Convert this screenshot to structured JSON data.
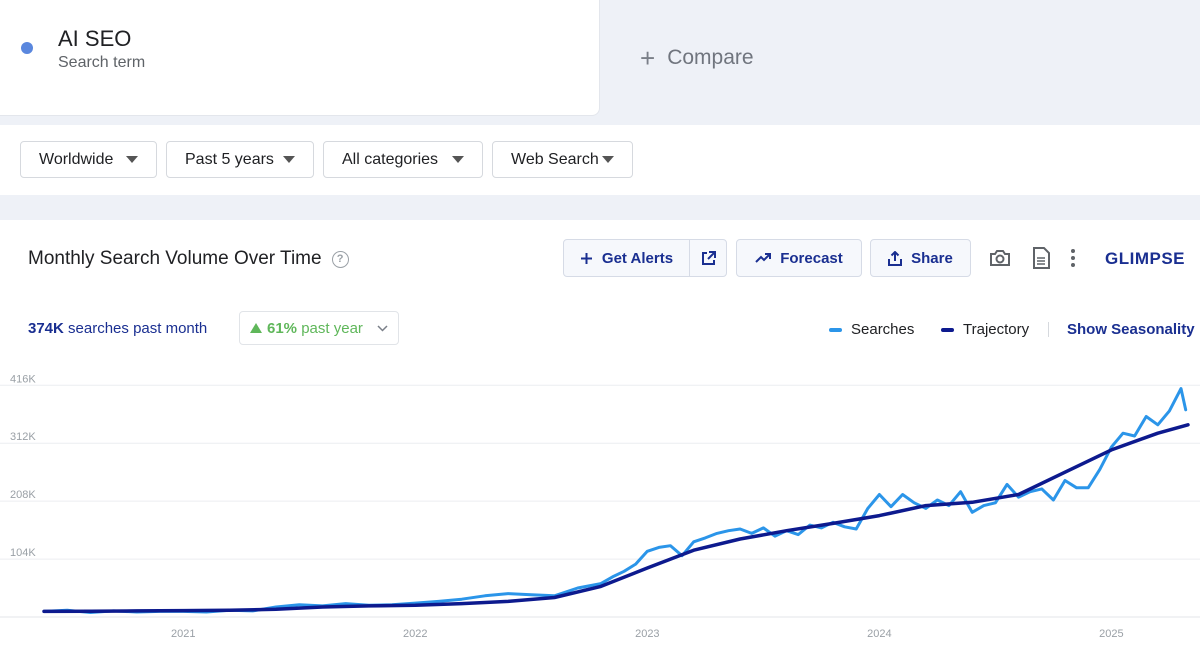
{
  "search_term": {
    "title": "AI SEO",
    "subtitle": "Search term",
    "dot_color": "#5a87de"
  },
  "compare": {
    "label": "Compare"
  },
  "filters": {
    "region": "Worldwide",
    "period": "Past 5 years",
    "category": "All categories",
    "source": "Web Search"
  },
  "panel": {
    "title": "Monthly Search Volume Over Time",
    "get_alerts": "Get Alerts",
    "forecast": "Forecast",
    "share": "Share",
    "logo": "GLIMPSE",
    "stat_value": "374K",
    "stat_label": "searches past month",
    "growth_value": "61%",
    "growth_label": "past year",
    "legend_searches": "Searches",
    "legend_trajectory": "Trajectory",
    "show_seasonality": "Show Seasonality"
  },
  "colors": {
    "searches": "#2b95e9",
    "trajectory": "#0d1a8e",
    "accent": "#1a2f91",
    "growth": "#5fb75a"
  },
  "chart_data": {
    "type": "line",
    "title": "Monthly Search Volume Over Time",
    "y_ticks": [
      "104K",
      "208K",
      "312K",
      "416K"
    ],
    "y_tick_values": [
      104000,
      208000,
      312000,
      416000
    ],
    "x_ticks": [
      "2021",
      "2022",
      "2023",
      "2024",
      "2025"
    ],
    "x_tick_values": [
      2021,
      2022,
      2023,
      2024,
      2025
    ],
    "xlim": [
      2020.37,
      2025.35
    ],
    "ylim": [
      0,
      460000
    ],
    "grid": true,
    "legend_position": "top-right",
    "series": [
      {
        "name": "Searches",
        "x": [
          2020.4,
          2020.5,
          2020.6,
          2020.7,
          2020.8,
          2020.9,
          2021.0,
          2021.1,
          2021.2,
          2021.3,
          2021.4,
          2021.5,
          2021.6,
          2021.7,
          2021.8,
          2021.9,
          2022.0,
          2022.1,
          2022.2,
          2022.3,
          2022.4,
          2022.5,
          2022.6,
          2022.7,
          2022.8,
          2022.85,
          2022.9,
          2022.95,
          2023.0,
          2023.05,
          2023.1,
          2023.15,
          2023.2,
          2023.25,
          2023.3,
          2023.35,
          2023.4,
          2023.45,
          2023.5,
          2023.55,
          2023.6,
          2023.65,
          2023.7,
          2023.75,
          2023.8,
          2023.85,
          2023.9,
          2023.95,
          2024.0,
          2024.05,
          2024.1,
          2024.15,
          2024.2,
          2024.25,
          2024.3,
          2024.35,
          2024.4,
          2024.45,
          2024.5,
          2024.55,
          2024.6,
          2024.65,
          2024.7,
          2024.75,
          2024.8,
          2024.85,
          2024.9,
          2024.95,
          2025.0,
          2025.05,
          2025.1,
          2025.15,
          2025.2,
          2025.25,
          2025.3,
          2025.32
        ],
        "values": [
          10000,
          12000,
          8000,
          11000,
          9000,
          10000,
          10000,
          9000,
          12000,
          11000,
          18000,
          22000,
          20000,
          24000,
          21000,
          22000,
          25000,
          28000,
          32000,
          38000,
          42000,
          40000,
          38000,
          52000,
          60000,
          72000,
          82000,
          95000,
          118000,
          125000,
          128000,
          110000,
          135000,
          142000,
          150000,
          155000,
          158000,
          150000,
          160000,
          145000,
          155000,
          148000,
          165000,
          160000,
          170000,
          162000,
          158000,
          195000,
          220000,
          198000,
          220000,
          205000,
          195000,
          210000,
          200000,
          225000,
          188000,
          200000,
          205000,
          238000,
          215000,
          225000,
          230000,
          210000,
          245000,
          232000,
          232000,
          265000,
          305000,
          330000,
          325000,
          360000,
          345000,
          370000,
          410000,
          372000
        ]
      },
      {
        "name": "Trajectory",
        "x": [
          2020.4,
          2020.6,
          2020.8,
          2021.0,
          2021.2,
          2021.4,
          2021.6,
          2021.8,
          2022.0,
          2022.2,
          2022.4,
          2022.6,
          2022.8,
          2023.0,
          2023.2,
          2023.4,
          2023.6,
          2023.8,
          2024.0,
          2024.2,
          2024.4,
          2024.6,
          2024.8,
          2025.0,
          2025.2,
          2025.33
        ],
        "values": [
          10000,
          10500,
          11000,
          11500,
          12000,
          14000,
          18000,
          20000,
          21000,
          24000,
          28000,
          35000,
          55000,
          88000,
          120000,
          140000,
          155000,
          168000,
          182000,
          200000,
          206000,
          220000,
          260000,
          300000,
          330000,
          345000
        ]
      }
    ]
  }
}
